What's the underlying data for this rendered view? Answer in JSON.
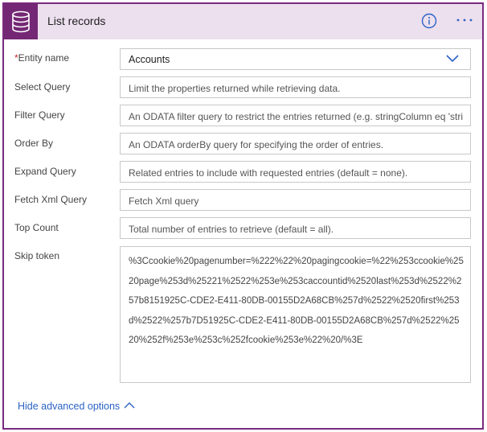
{
  "header": {
    "title": "List records",
    "connector_icon": "database-icon",
    "info_icon": "info-icon",
    "more_icon": "ellipsis-icon"
  },
  "fields": {
    "entity": {
      "label": "Entity name",
      "required_mark": "*",
      "value": "Accounts"
    },
    "select_query": {
      "label": "Select Query",
      "placeholder": "Limit the properties returned while retrieving data."
    },
    "filter_query": {
      "label": "Filter Query",
      "placeholder": "An ODATA filter query to restrict the entries returned (e.g. stringColumn eq 'stri"
    },
    "order_by": {
      "label": "Order By",
      "placeholder": "An ODATA orderBy query for specifying the order of entries."
    },
    "expand_query": {
      "label": "Expand Query",
      "placeholder": "Related entries to include with requested entries (default = none)."
    },
    "fetch_xml": {
      "label": "Fetch Xml Query",
      "placeholder": "Fetch Xml query"
    },
    "top_count": {
      "label": "Top Count",
      "placeholder": "Total number of entries to retrieve (default = all)."
    },
    "skip_token": {
      "label": "Skip token",
      "value": "%3Ccookie%20pagenumber=%222%22%20pagingcookie=%22%253ccookie%2520page%253d%25221%2522%253e%253caccountid%2520last%253d%2522%257b8151925C-CDE2-E411-80DB-00155D2A68CB%257d%2522%2520first%253d%2522%257b7D51925C-CDE2-E411-80DB-00155D2A68CB%257d%2522%2520%252f%253e%253c%252fcookie%253e%22%20/%3E"
    }
  },
  "footer": {
    "advanced_label": "Hide advanced options"
  },
  "colors": {
    "accent": "#742774",
    "header_bg": "#ecdfee",
    "link": "#2b62c4"
  }
}
